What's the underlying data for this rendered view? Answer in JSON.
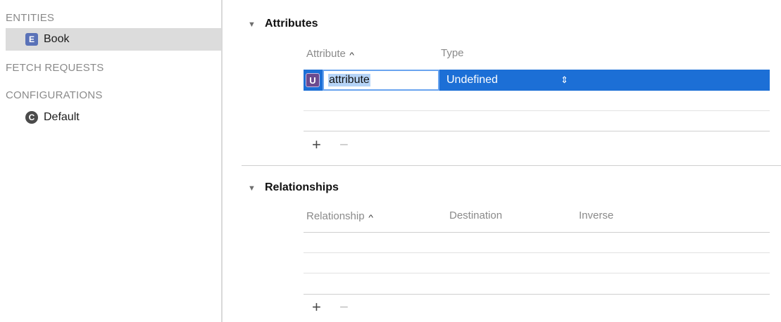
{
  "sidebar": {
    "entities_header": "ENTITIES",
    "entities": [
      {
        "badge": "E",
        "label": "Book",
        "selected": true
      }
    ],
    "fetch_requests_header": "FETCH REQUESTS",
    "configurations_header": "CONFIGURATIONS",
    "configurations": [
      {
        "badge": "C",
        "label": "Default"
      }
    ]
  },
  "attributes": {
    "title": "Attributes",
    "columns": {
      "attribute": "Attribute",
      "type": "Type"
    },
    "row": {
      "badge": "U",
      "name": "attribute",
      "type": "Undefined",
      "stepper": "⌃⌄"
    },
    "add_label": "+",
    "remove_label": "−"
  },
  "relationships": {
    "title": "Relationships",
    "columns": {
      "relationship": "Relationship",
      "destination": "Destination",
      "inverse": "Inverse"
    },
    "add_label": "+",
    "remove_label": "−"
  },
  "icons": {
    "disclosure": "disclosure-triangle-icon",
    "sort": "sort-ascending-icon"
  },
  "colors": {
    "selection_blue": "#1c6fd6",
    "entity_badge": "#5a72b8",
    "attribute_badge": "#6b4a8f"
  }
}
